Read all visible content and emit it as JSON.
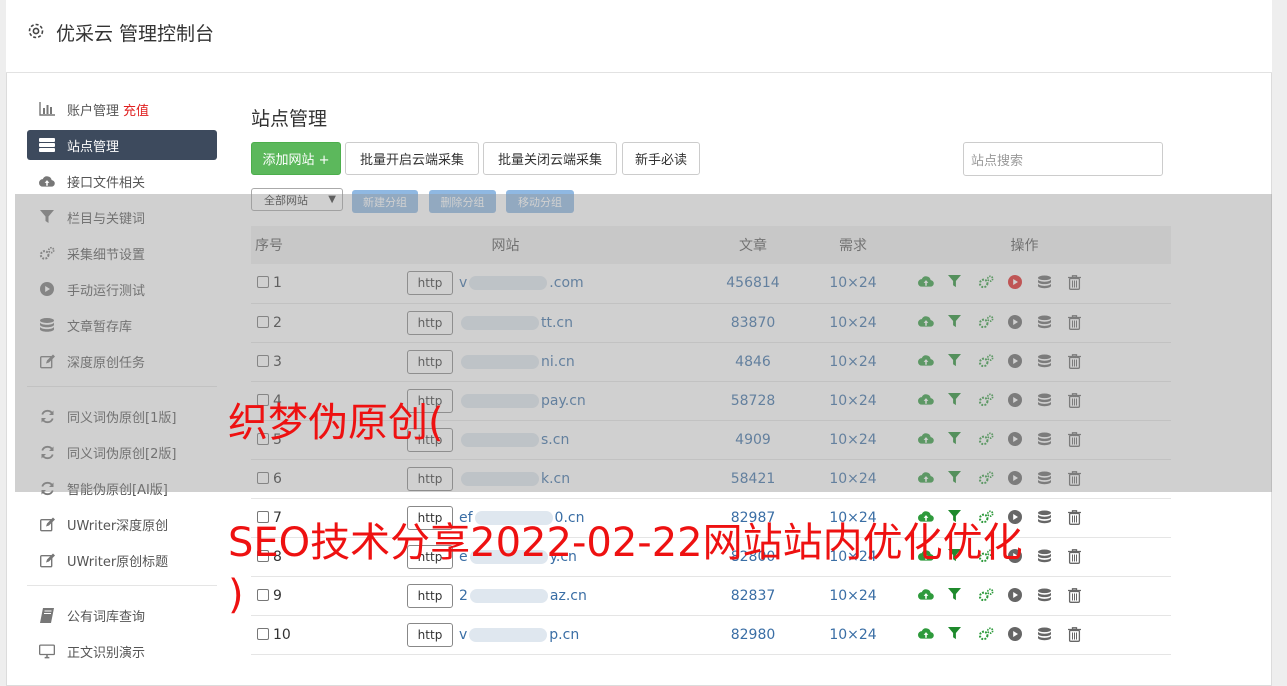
{
  "header": {
    "title": "优采云 管理控制台"
  },
  "sidebar": {
    "items": [
      {
        "label": "账户管理",
        "extra": "充值",
        "icon": "bar-chart-icon"
      },
      {
        "label": "站点管理",
        "icon": "server-icon"
      },
      {
        "label": "接口文件相关",
        "icon": "cloud-upload-icon"
      },
      {
        "label": "栏目与关键词",
        "icon": "filter-icon"
      },
      {
        "label": "采集细节设置",
        "icon": "gears-icon"
      },
      {
        "label": "手动运行测试",
        "icon": "play-circle-icon"
      },
      {
        "label": "文章暂存库",
        "icon": "database-icon"
      },
      {
        "label": "深度原创任务",
        "icon": "edit-icon"
      }
    ],
    "items2": [
      {
        "label": "同义词伪原创[1版]",
        "icon": "refresh-icon"
      },
      {
        "label": "同义词伪原创[2版]",
        "icon": "refresh-icon"
      },
      {
        "label": "智能伪原创[AI版]",
        "icon": "refresh-icon"
      },
      {
        "label": "UWriter深度原创",
        "icon": "edit-icon"
      },
      {
        "label": "UWriter原创标题",
        "icon": "edit-icon"
      }
    ],
    "items3": [
      {
        "label": "公有词库查询",
        "icon": "book-icon"
      },
      {
        "label": "正文识别演示",
        "icon": "monitor-icon"
      }
    ]
  },
  "main": {
    "title": "站点管理",
    "buttons": {
      "add": "添加网站 +",
      "batch_on": "批量开启云端采集",
      "batch_off": "批量关闭云端采集",
      "guide": "新手必读"
    },
    "search_placeholder": "站点搜索",
    "group_select": "全部网站",
    "group_buttons": {
      "new": "新建分组",
      "delete": "删除分组",
      "move": "移动分组"
    },
    "table": {
      "headers": {
        "no": "序号",
        "site": "网站",
        "articles": "文章",
        "demand": "需求",
        "ops": "操作"
      },
      "rows": [
        {
          "no": "1",
          "proto": "http",
          "pre": "v",
          "suf": ".com",
          "articles": "456814",
          "demand": "10×24",
          "active": true
        },
        {
          "no": "2",
          "proto": "http",
          "pre": "",
          "suf": "tt.cn",
          "articles": "83870",
          "demand": "10×24",
          "active": false
        },
        {
          "no": "3",
          "proto": "http",
          "pre": "",
          "suf": "ni.cn",
          "articles": "4846",
          "demand": "10×24",
          "active": false
        },
        {
          "no": "4",
          "proto": "http",
          "pre": "",
          "suf": "pay.cn",
          "articles": "58728",
          "demand": "10×24",
          "active": false
        },
        {
          "no": "5",
          "proto": "http",
          "pre": "",
          "suf": "s.cn",
          "articles": "4909",
          "demand": "10×24",
          "active": false
        },
        {
          "no": "6",
          "proto": "http",
          "pre": "",
          "suf": "k.cn",
          "articles": "58421",
          "demand": "10×24",
          "active": false
        },
        {
          "no": "7",
          "proto": "http",
          "pre": "ef",
          "suf": "0.cn",
          "articles": "82987",
          "demand": "10×24",
          "active": false
        },
        {
          "no": "8",
          "proto": "http",
          "pre": "e",
          "suf": "y.cn",
          "articles": "82800",
          "demand": "10×24",
          "active": false
        },
        {
          "no": "9",
          "proto": "http",
          "pre": "2",
          "suf": "az.cn",
          "articles": "82837",
          "demand": "10×24",
          "active": false
        },
        {
          "no": "10",
          "proto": "http",
          "pre": "v",
          "suf": "p.cn",
          "articles": "82980",
          "demand": "10×24",
          "active": false
        }
      ]
    }
  },
  "watermark": {
    "line1": "织梦伪原创(",
    "line2": "SEO技术分享2022-02-22网站站内优化优化",
    "line3": ")"
  },
  "colors": {
    "green": "#5cb85c",
    "sidebar_active": "#3d4a5d",
    "link": "#3a6ea5",
    "watermark": "#ee1111",
    "run_active": "#e02020"
  }
}
